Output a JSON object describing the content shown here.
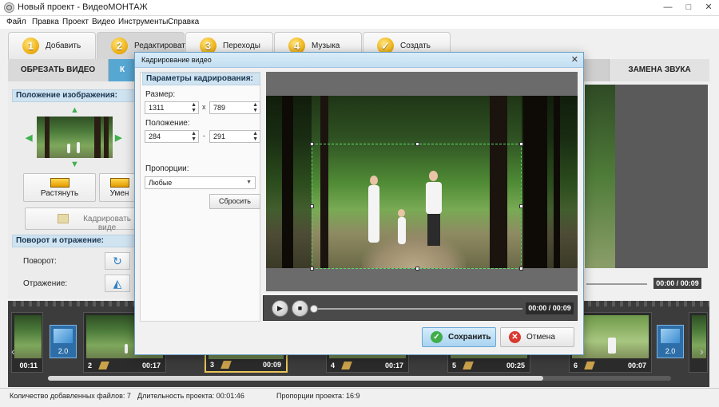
{
  "window": {
    "title": "Новый проект - ВидеоМОНТАЖ",
    "minimize": "—",
    "maximize": "□",
    "close": "✕"
  },
  "menu": [
    "Файл",
    "Правка",
    "Проект",
    "Видео",
    "Инструменты",
    "Справка"
  ],
  "steps": [
    {
      "num": "1",
      "label": "Добавить"
    },
    {
      "num": "2",
      "label": "Редактировать"
    },
    {
      "num": "3",
      "label": "Переходы"
    },
    {
      "num": "4",
      "label": "Музыка"
    },
    {
      "num": "✓",
      "label": "Создать"
    }
  ],
  "subtabs": {
    "cut": "ОБРЕЗАТЬ ВИДЕО",
    "crop": "К",
    "sound": "ЗАМЕНА ЗВУКА"
  },
  "left": {
    "position_head": "Положение изображения:",
    "stretch": "Растянуть",
    "shrink": "Умен",
    "crop_video": "Кадрировать виде",
    "rotation_head": "Поворот и отражение:",
    "rotate_label": "Поворот:",
    "mirror_label": "Отражение:"
  },
  "bg_preview": {
    "time": "00:00 / 00:09"
  },
  "timeline": {
    "clips": [
      {
        "num": "",
        "dur": "00:11"
      },
      {
        "num": "2",
        "dur": "00:17"
      },
      {
        "num": "3",
        "dur": "00:09"
      },
      {
        "num": "4",
        "dur": "00:17"
      },
      {
        "num": "5",
        "dur": "00:25"
      },
      {
        "num": "6",
        "dur": "00:07"
      }
    ],
    "transitions": [
      "2.0",
      "2.0"
    ]
  },
  "status": {
    "files": "Количество добавленных файлов: 7",
    "duration": "Длительность проекта:  00:01:46",
    "ratio": "Пропорции проекта:  16:9"
  },
  "dialog": {
    "title": "Кадрирование видео",
    "close": "✕",
    "params_head": "Параметры кадрирования:",
    "size_label": "Размер:",
    "size_w": "1311",
    "size_x": "x",
    "size_h": "789",
    "pos_label": "Положение:",
    "pos_x": "284",
    "pos_sep": "-",
    "pos_y": "291",
    "ratio_label": "Пропорции:",
    "ratio_value": "Любые",
    "reset": "Сбросить",
    "time": "00:00 / 00:09",
    "save": "Сохранить",
    "cancel": "Отмена"
  }
}
